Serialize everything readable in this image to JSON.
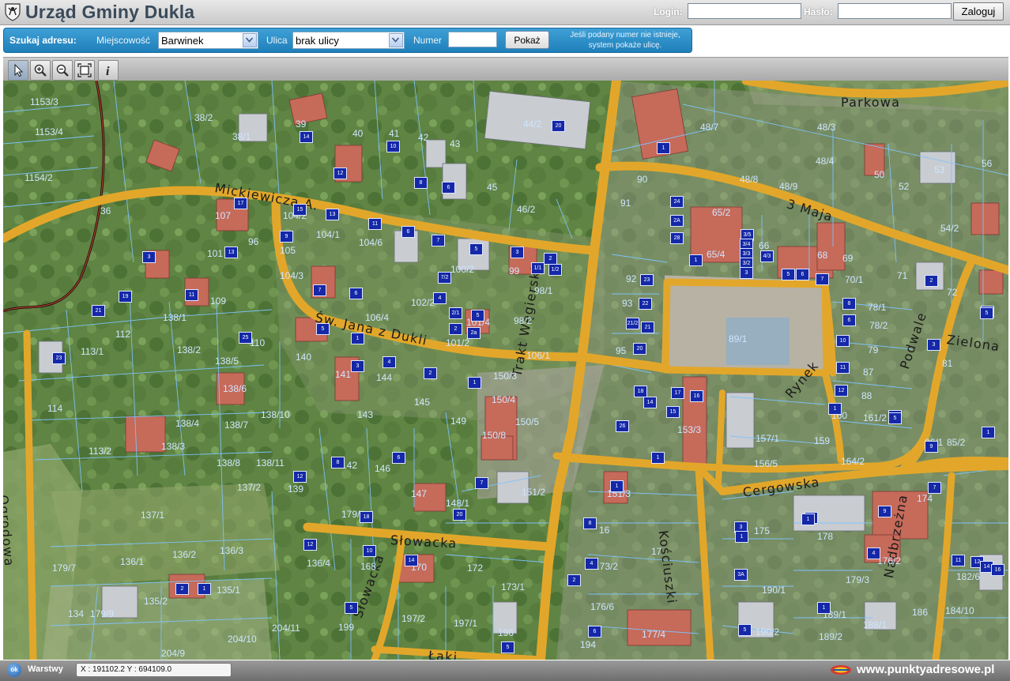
{
  "header": {
    "title": "Urząd Gminy Dukla",
    "login_label": "Login:",
    "password_label": "Hasło:",
    "login_button": "Zaloguj"
  },
  "search": {
    "heading": "Szukaj adresu:",
    "town_label": "Miejscowość",
    "town_value": "Barwinek",
    "street_label": "Ulica",
    "street_value": "brak ulicy",
    "number_label": "Numer",
    "show_button": "Pokaż",
    "hint_line1": "Jeśli podany numer nie istnieje,",
    "hint_line2": "system pokaże ulicę."
  },
  "toolbar": {
    "tools": [
      {
        "name": "pointer-icon",
        "active": true
      },
      {
        "name": "zoom-in-icon",
        "active": false
      },
      {
        "name": "zoom-out-icon",
        "active": false
      },
      {
        "name": "full-extent-icon",
        "active": false
      },
      {
        "name": "info-icon",
        "active": false
      }
    ]
  },
  "map": {
    "streets": [
      {
        "label": "Parkowa"
      },
      {
        "label": "Mickiewicza A."
      },
      {
        "label": "3 Maja"
      },
      {
        "label": "Św. Jana z Dukli"
      },
      {
        "label": "Trakt Węgierski"
      },
      {
        "label": "Rynek"
      },
      {
        "label": "Podwale"
      },
      {
        "label": "Zielona"
      },
      {
        "label": "Cergowska"
      },
      {
        "label": "Kościuszki"
      },
      {
        "label": "Ogrodowa"
      },
      {
        "label": "Słowacka"
      },
      {
        "label": "Słowacka"
      },
      {
        "label": "Nadbrzeżna"
      },
      {
        "label": "Łąki"
      }
    ],
    "plots": [
      "1153/3",
      "38/2",
      "39",
      "40",
      "41",
      "42",
      "43",
      "44/2",
      "48/7",
      "48/3",
      "48/4",
      "1153/4",
      "50",
      "53",
      "56",
      "1154/2",
      "38/1",
      "45",
      "48/8",
      "48/9",
      "52",
      "36",
      "46/2",
      "90",
      "91",
      "65/2",
      "107",
      "104/2",
      "104/1",
      "104/6",
      "54/2",
      "96",
      "105",
      "101",
      "99",
      "98/1",
      "65/4",
      "68",
      "69",
      "70/1",
      "71",
      "72",
      "104/3",
      "109",
      "106/4",
      "102/2",
      "100/2",
      "66",
      "92",
      "93",
      "78/1",
      "78/2",
      "89/1",
      "79",
      "87",
      "81",
      "138/1",
      "112",
      "110",
      "101/4",
      "101/2",
      "98/2",
      "106/1",
      "95",
      "140",
      "113/1",
      "138/2",
      "138/5",
      "150/3",
      "141",
      "144",
      "88",
      "161/2",
      "160",
      "138/6",
      "145",
      "149",
      "150/4",
      "150/5",
      "114",
      "138/10",
      "143",
      "138/7",
      "138/4",
      "150/8",
      "153/3",
      "157/1",
      "159",
      "85/2",
      "86/1",
      "113/2",
      "138/3",
      "156/5",
      "164/2",
      "138/8",
      "138/11",
      "142",
      "146",
      "137/2",
      "139",
      "137/1",
      "147",
      "148/1",
      "151/2",
      "151/3",
      "174",
      "179/1",
      "16",
      "175",
      "178",
      "179/7",
      "136/1",
      "136/2",
      "136/3",
      "136/4",
      "168",
      "170",
      "172",
      "173/1",
      "173/2",
      "176/2",
      "179/3",
      "179/9",
      "135/2",
      "135/1",
      "134",
      "197/2",
      "197/1",
      "199",
      "196",
      "176/6",
      "188/1",
      "189/1",
      "190/2",
      "189/2",
      "186",
      "184/10",
      "182/6",
      "204/10",
      "204/11",
      "204/9",
      "194",
      "177/4",
      "17",
      "190/1",
      "176"
    ],
    "house_numbers": [
      "14",
      "10",
      "12",
      "8",
      "6",
      "20",
      "1",
      "17",
      "15",
      "13",
      "11",
      "6",
      "7",
      "5",
      "3",
      "2",
      "1/1",
      "1/2",
      "4",
      "7/2",
      "5",
      "2/1",
      "2",
      "2a",
      "3",
      "19",
      "21",
      "23",
      "25",
      "11",
      "13",
      "9",
      "7",
      "5",
      "6",
      "1",
      "3",
      "4",
      "2",
      "1",
      "28",
      "2A",
      "24",
      "3/5",
      "3/4",
      "3/3",
      "3/2",
      "3",
      "4/3",
      "6",
      "5",
      "7",
      "1",
      "23",
      "22",
      "21/2",
      "21",
      "20",
      "8",
      "6",
      "10",
      "11",
      "12",
      "1",
      "13",
      "2",
      "3",
      "19",
      "18",
      "17",
      "16",
      "15",
      "14",
      "26",
      "1",
      "8",
      "6",
      "12",
      "9",
      "3",
      "1",
      "12",
      "14",
      "18",
      "20",
      "2",
      "1",
      "10",
      "5",
      "7",
      "1",
      "8",
      "4",
      "2",
      "6",
      "5",
      "1",
      "3A",
      "5",
      "1",
      "4",
      "1",
      "5",
      "5",
      "7",
      "9",
      "1",
      "11",
      "12",
      "14",
      "16",
      "18"
    ]
  },
  "footer": {
    "ok_icon_text": "ok",
    "layers_label": "Warstwy",
    "coordinates": "X : 191102.2  Y : 694109.0",
    "brand": "www.punktyadresowe.pl"
  }
}
